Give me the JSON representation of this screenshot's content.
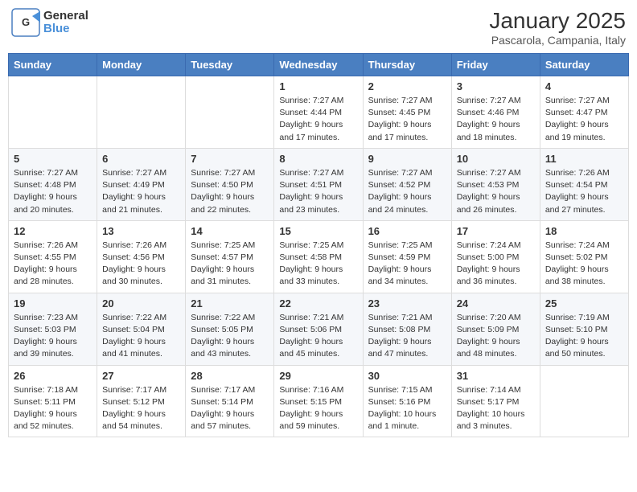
{
  "header": {
    "logo": {
      "general": "General",
      "blue": "Blue"
    },
    "month": "January 2025",
    "location": "Pascarola, Campania, Italy"
  },
  "weekdays": [
    "Sunday",
    "Monday",
    "Tuesday",
    "Wednesday",
    "Thursday",
    "Friday",
    "Saturday"
  ],
  "weeks": [
    [
      {
        "day": "",
        "info": ""
      },
      {
        "day": "",
        "info": ""
      },
      {
        "day": "",
        "info": ""
      },
      {
        "day": "1",
        "info": "Sunrise: 7:27 AM\nSunset: 4:44 PM\nDaylight: 9 hours\nand 17 minutes."
      },
      {
        "day": "2",
        "info": "Sunrise: 7:27 AM\nSunset: 4:45 PM\nDaylight: 9 hours\nand 17 minutes."
      },
      {
        "day": "3",
        "info": "Sunrise: 7:27 AM\nSunset: 4:46 PM\nDaylight: 9 hours\nand 18 minutes."
      },
      {
        "day": "4",
        "info": "Sunrise: 7:27 AM\nSunset: 4:47 PM\nDaylight: 9 hours\nand 19 minutes."
      }
    ],
    [
      {
        "day": "5",
        "info": "Sunrise: 7:27 AM\nSunset: 4:48 PM\nDaylight: 9 hours\nand 20 minutes."
      },
      {
        "day": "6",
        "info": "Sunrise: 7:27 AM\nSunset: 4:49 PM\nDaylight: 9 hours\nand 21 minutes."
      },
      {
        "day": "7",
        "info": "Sunrise: 7:27 AM\nSunset: 4:50 PM\nDaylight: 9 hours\nand 22 minutes."
      },
      {
        "day": "8",
        "info": "Sunrise: 7:27 AM\nSunset: 4:51 PM\nDaylight: 9 hours\nand 23 minutes."
      },
      {
        "day": "9",
        "info": "Sunrise: 7:27 AM\nSunset: 4:52 PM\nDaylight: 9 hours\nand 24 minutes."
      },
      {
        "day": "10",
        "info": "Sunrise: 7:27 AM\nSunset: 4:53 PM\nDaylight: 9 hours\nand 26 minutes."
      },
      {
        "day": "11",
        "info": "Sunrise: 7:26 AM\nSunset: 4:54 PM\nDaylight: 9 hours\nand 27 minutes."
      }
    ],
    [
      {
        "day": "12",
        "info": "Sunrise: 7:26 AM\nSunset: 4:55 PM\nDaylight: 9 hours\nand 28 minutes."
      },
      {
        "day": "13",
        "info": "Sunrise: 7:26 AM\nSunset: 4:56 PM\nDaylight: 9 hours\nand 30 minutes."
      },
      {
        "day": "14",
        "info": "Sunrise: 7:25 AM\nSunset: 4:57 PM\nDaylight: 9 hours\nand 31 minutes."
      },
      {
        "day": "15",
        "info": "Sunrise: 7:25 AM\nSunset: 4:58 PM\nDaylight: 9 hours\nand 33 minutes."
      },
      {
        "day": "16",
        "info": "Sunrise: 7:25 AM\nSunset: 4:59 PM\nDaylight: 9 hours\nand 34 minutes."
      },
      {
        "day": "17",
        "info": "Sunrise: 7:24 AM\nSunset: 5:00 PM\nDaylight: 9 hours\nand 36 minutes."
      },
      {
        "day": "18",
        "info": "Sunrise: 7:24 AM\nSunset: 5:02 PM\nDaylight: 9 hours\nand 38 minutes."
      }
    ],
    [
      {
        "day": "19",
        "info": "Sunrise: 7:23 AM\nSunset: 5:03 PM\nDaylight: 9 hours\nand 39 minutes."
      },
      {
        "day": "20",
        "info": "Sunrise: 7:22 AM\nSunset: 5:04 PM\nDaylight: 9 hours\nand 41 minutes."
      },
      {
        "day": "21",
        "info": "Sunrise: 7:22 AM\nSunset: 5:05 PM\nDaylight: 9 hours\nand 43 minutes."
      },
      {
        "day": "22",
        "info": "Sunrise: 7:21 AM\nSunset: 5:06 PM\nDaylight: 9 hours\nand 45 minutes."
      },
      {
        "day": "23",
        "info": "Sunrise: 7:21 AM\nSunset: 5:08 PM\nDaylight: 9 hours\nand 47 minutes."
      },
      {
        "day": "24",
        "info": "Sunrise: 7:20 AM\nSunset: 5:09 PM\nDaylight: 9 hours\nand 48 minutes."
      },
      {
        "day": "25",
        "info": "Sunrise: 7:19 AM\nSunset: 5:10 PM\nDaylight: 9 hours\nand 50 minutes."
      }
    ],
    [
      {
        "day": "26",
        "info": "Sunrise: 7:18 AM\nSunset: 5:11 PM\nDaylight: 9 hours\nand 52 minutes."
      },
      {
        "day": "27",
        "info": "Sunrise: 7:17 AM\nSunset: 5:12 PM\nDaylight: 9 hours\nand 54 minutes."
      },
      {
        "day": "28",
        "info": "Sunrise: 7:17 AM\nSunset: 5:14 PM\nDaylight: 9 hours\nand 57 minutes."
      },
      {
        "day": "29",
        "info": "Sunrise: 7:16 AM\nSunset: 5:15 PM\nDaylight: 9 hours\nand 59 minutes."
      },
      {
        "day": "30",
        "info": "Sunrise: 7:15 AM\nSunset: 5:16 PM\nDaylight: 10 hours\nand 1 minute."
      },
      {
        "day": "31",
        "info": "Sunrise: 7:14 AM\nSunset: 5:17 PM\nDaylight: 10 hours\nand 3 minutes."
      },
      {
        "day": "",
        "info": ""
      }
    ]
  ]
}
